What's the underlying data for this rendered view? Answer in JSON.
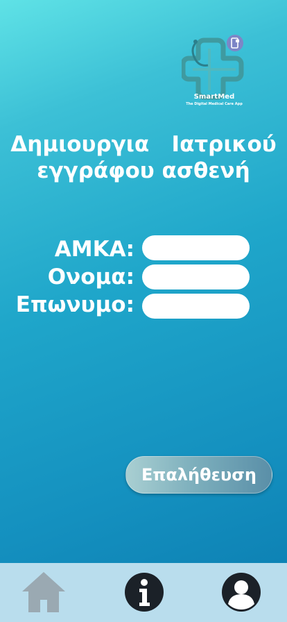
{
  "app": {
    "logo_name": "SmartMed",
    "logo_tagline": "The Digital Medical Care App"
  },
  "header": {
    "title_line1": "Δημιουργια   Ιατρικού",
    "title_line2": "εγγράφου ασθενή"
  },
  "form": {
    "amka_label": "ΑΜΚΑ:",
    "amka_value": "",
    "name_label": "Ονομα:",
    "name_value": "",
    "surname_label": "Επωνυμο:",
    "surname_value": ""
  },
  "actions": {
    "verify_label": "Επαλήθευση"
  },
  "bottom_nav": {
    "items": [
      {
        "icon": "home-icon"
      },
      {
        "icon": "info-icon"
      },
      {
        "icon": "user-profile-icon"
      }
    ]
  },
  "colors": {
    "background_top": "#5fe2e6",
    "background_bottom": "#0b7cb0",
    "nav_background": "#b9dded",
    "icon_dark": "#1b2128",
    "home_icon": "#9aa9b2"
  }
}
